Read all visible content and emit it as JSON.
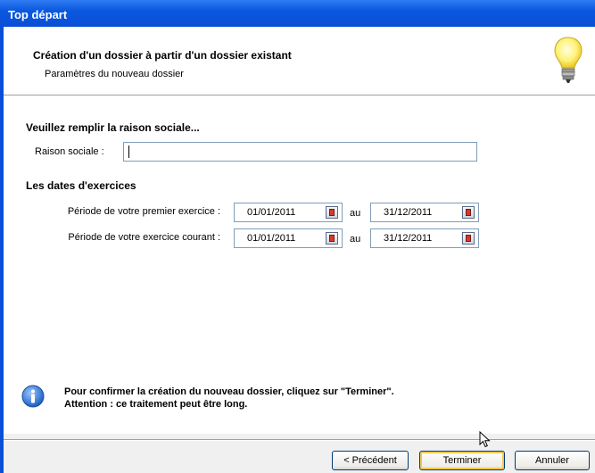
{
  "window": {
    "title": "Top départ"
  },
  "header": {
    "title": "Création d'un dossier à partir d'un dossier existant",
    "subtitle": "Paramètres du nouveau dossier",
    "icon": "lightbulb-icon"
  },
  "form": {
    "section1_title": "Veuillez remplir la raison sociale...",
    "raison_label": "Raison sociale :",
    "raison_value": "",
    "section2_title": "Les dates d'exercices",
    "rows": [
      {
        "label": "Période de votre premier exercice :",
        "start": "01/01/2011",
        "sep": "au",
        "end": "31/12/2011"
      },
      {
        "label": "Période de votre exercice courant :",
        "start": "01/01/2011",
        "sep": "au",
        "end": "31/12/2011"
      }
    ]
  },
  "info": {
    "icon": "info-icon",
    "line1": "Pour confirmer la création du nouveau dossier, cliquez sur \"Terminer\".",
    "line2": "Attention : ce traitement peut être long."
  },
  "buttons": {
    "prev": "< Précédent",
    "finish": "Terminer",
    "cancel": "Annuler"
  }
}
